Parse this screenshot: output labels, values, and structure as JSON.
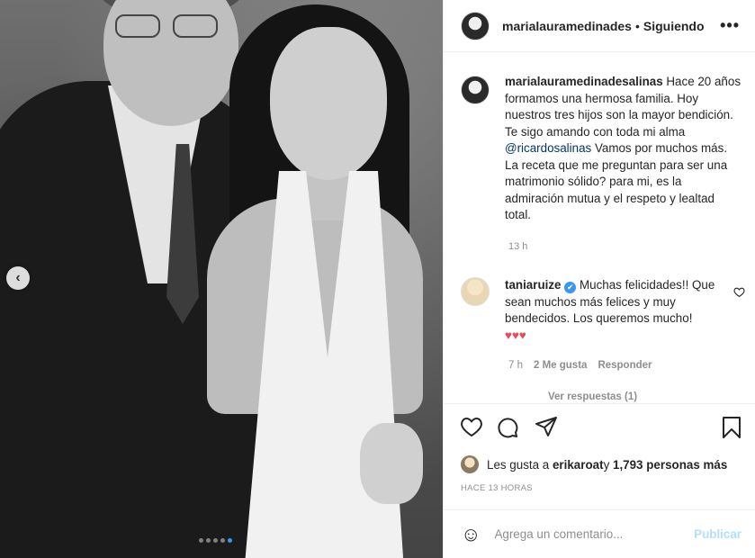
{
  "photo": {
    "carousel_count": 5,
    "active_index": 4
  },
  "header": {
    "username": "marialauramedinades",
    "separator": "•",
    "following": "Siguiendo",
    "more": "•••"
  },
  "caption": {
    "username": "marialauramedinadesalinas",
    "text_before_mention": " Hace 20 años formamos una hermosa familia. Hoy nuestros tres hijos son la mayor bendición. Te sigo amando con toda mi alma ",
    "mention": "@ricardosalinas",
    "text_after_mention": " Vamos por muchos más. La receta que me preguntan para ser una matrimonio sólido? para mi, es la admiración mutua y el respeto y lealtad total.",
    "time": "13 h"
  },
  "comment": {
    "username": "taniaruize",
    "verified_icon": "✔",
    "text": " Muchas felicidades!! Que sean muchos más felices y muy bendecidos. Los queremos mucho!",
    "hearts": "♥♥♥",
    "time": "7 h",
    "likes": "2 Me gusta",
    "reply": "Responder",
    "view_replies": "Ver respuestas (1)"
  },
  "likes": {
    "prefix": "Les gusta a ",
    "user": "erikaroat",
    "middle": " y ",
    "count": "1,793 personas más"
  },
  "posted_ago": "Hace 13 horas",
  "add_comment": {
    "placeholder": "Agrega un comentario...",
    "publish": "Publicar"
  },
  "colors": {
    "link": "#00376b",
    "verified": "#3897f0",
    "heart": "#ed4956",
    "publish_disabled": "#b2dffc"
  },
  "icons": [
    "chevron-left-icon",
    "heart-icon",
    "comment-icon",
    "share-icon",
    "bookmark-icon",
    "emoji-icon",
    "verified-icon"
  ]
}
